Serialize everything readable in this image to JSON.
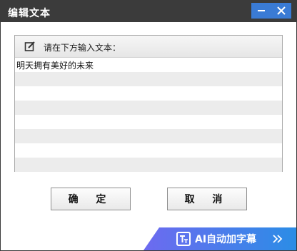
{
  "window": {
    "title": "编辑文本"
  },
  "titlebar": {
    "minimize_icon": "minimize-icon",
    "close_icon": "close-icon",
    "accent": "#3a7bd5"
  },
  "panel": {
    "header_label": "请在下方输入文本：",
    "header_icon": "edit-icon",
    "lines": [
      "明天拥有美好的未来",
      "",
      "",
      "",
      "",
      "",
      "",
      ""
    ]
  },
  "buttons": {
    "ok": "确 定",
    "cancel": "取 消"
  },
  "banner": {
    "label": "AI自动加字幕",
    "icon": "subtitle-icon",
    "chevron_icon": "double-chevron-right-icon"
  }
}
